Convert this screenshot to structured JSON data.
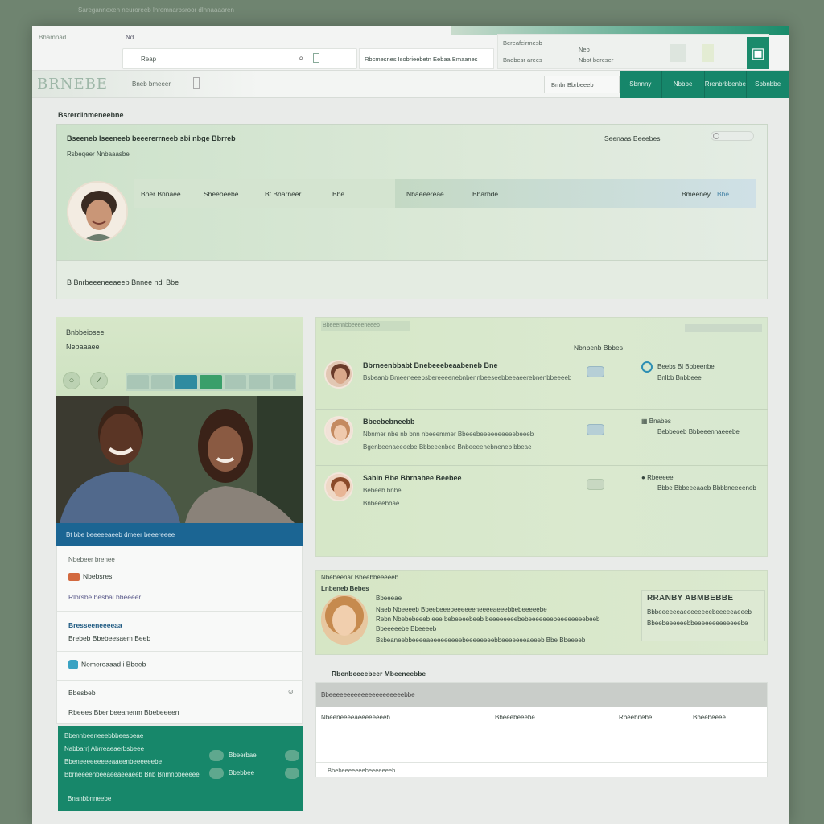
{
  "caption": "Saregannexen neuroreeb lnremnarbsroor dlnnaaaaren",
  "chrome": {
    "app_name": "Bhamnad",
    "tab_label": "Nd",
    "url": "Reap",
    "address_text": "Rbcmesnes Isobrieebetn Eebaa Bmaanes",
    "right_line1": "Bereafeirmesb",
    "right_line2": "Bnebesr arees",
    "right_line3": "Neb",
    "right_line4": "Nbot bereser",
    "ext_icon": "puzzle-icon"
  },
  "nav": {
    "logo": "BRNEBE",
    "link1": "Bneb bmeeer",
    "search_label": "Bmbr Bbrbeeeb",
    "menu": [
      "Sbnnny",
      "Nbbbe",
      "Rrenbrbbenbe",
      "Sbbnbbe"
    ]
  },
  "profile": {
    "section_title": "Bsrerdlnmeneebne",
    "headline": "Bseeneb lseeneeb beeererrneeb sbi nbge Bbrreb",
    "subtitle": "Rsbeqeer Nnbaaasbe",
    "right_label": "Seenaas Beeebes",
    "stats": [
      "Bner Bnnaee",
      "Sbeeoeebe",
      "Bt Bnarneer",
      "Bbe",
      "Nbaeeereae",
      "Bbarbde",
      "Bmeeney",
      "Bbe"
    ],
    "footer": "B Bnrbeeeneeaeeb Bnnee ndl Bbe"
  },
  "left": {
    "top_line1": "Bnbbeiosee",
    "top_line2": "Nebaaaee",
    "photo_caption": "Bt bbe beeeeeaeeb dmeer beeereeee",
    "list_header": "Nbebeer brenee",
    "item1": "Nbebsres",
    "item2": "Rlbrsbe besbal bbeeeer",
    "item3_title": "Bresseeneeeeaa",
    "item3_sub": "Brebeb Bbebeesaem Beeb",
    "item4": "Nemereaaad i Bbeeb",
    "item5_label": "Bbesbeb",
    "item6": "Rbeees Bbenbeeanenm Bbebeeeen",
    "green_title": "Bbennbeeneeebbbeesbeae",
    "green_line1": "Nabbarr| Abrreaeaerbsbeee",
    "green_line2": "Bbeneeeeeeeeeaaeenbeeeeeebe",
    "green_line3": "Bbrneeeenbeeaeeaeeaeeb Bnb Bnmnbbeeeee",
    "green_pill1": "Bbeerbae",
    "green_pill2": "Bbebbee",
    "green_footer": "Bnanbbnneebe"
  },
  "messages": {
    "tab_label": "Bbeeennbbeeeeneeeb",
    "header": "Nbnbenb Bbbes",
    "rows": [
      {
        "name": "Bbrneenbbabt Bnebeeebeaabeneb Bne",
        "text": "Bsbeanb Bmeeneeebsbereeeenebnbennbeeseebbeeaeerebnenbbeeeeb",
        "text2": "",
        "side": "Beebs Bl Bbbeenbe",
        "side2": "Bnlbb Bnbbeee"
      },
      {
        "name": "Bbeebebneebb",
        "text": "Nbnmer nbe nb bnn nbeeemmer Bbeeebeeeeeeeeeebeeeb",
        "text2": "Bgenbeenaeeeebe Bbbeeenbee Bnbeeeenebneneb bbeae",
        "side": "Bnabes",
        "side2": "Bebbeoeb Bbbeeennaeeebe"
      },
      {
        "name": "Sabin Bbe Bbrnabee Beebee",
        "text": "Bebeeb bnbe",
        "text2": "Bnbeeebbae",
        "side": "Rbeeeee",
        "side2": "Bbbe Bbbeeeaaeb Bbbbneeeeneb"
      }
    ]
  },
  "feature": {
    "top": "Nbebeenar Bbeebbeeeeeb",
    "title": "Lnbeneb Bebes",
    "name": "Bbeeeae",
    "line1": "Naeb Nbeeeeb Bbeebeeebeeeeeeneeeeaeeebbebeeeeebe",
    "line2": "Rebn Nbebebeeeb eee bebeeeebeeb beeeeeeeebebeeeeeeebeeeeeeeebeeb",
    "line3": "Bbeeeeebe Bbeeeeb",
    "line4": "Bsbeaneebbeeeeaeeeeeeeeebeeeeeeeebbeeeeeeeaeeeb Bbe Bbeeeeb",
    "big": "RRANBY ABMBEBBE",
    "big_sub": "Bbbeeeeeeaeeeeeeeebeeeeeaeeeb",
    "big_sub2": "Bbeebeeeeeebbeeeeeeeeeeeeebe"
  },
  "table": {
    "title": "Rbenbeeeebeer Mbeeneebbe",
    "header": "Bbeeeeeeeeeeeeeeeeeeeeebbe",
    "cells": [
      "Nbeeneeeeaeeeeeeeeb",
      "Bbeeebeeebe",
      "Rbeebnebe",
      "Bbeebeeee"
    ],
    "footer": "Bbebeeeeeeebeeeeeeeb"
  }
}
